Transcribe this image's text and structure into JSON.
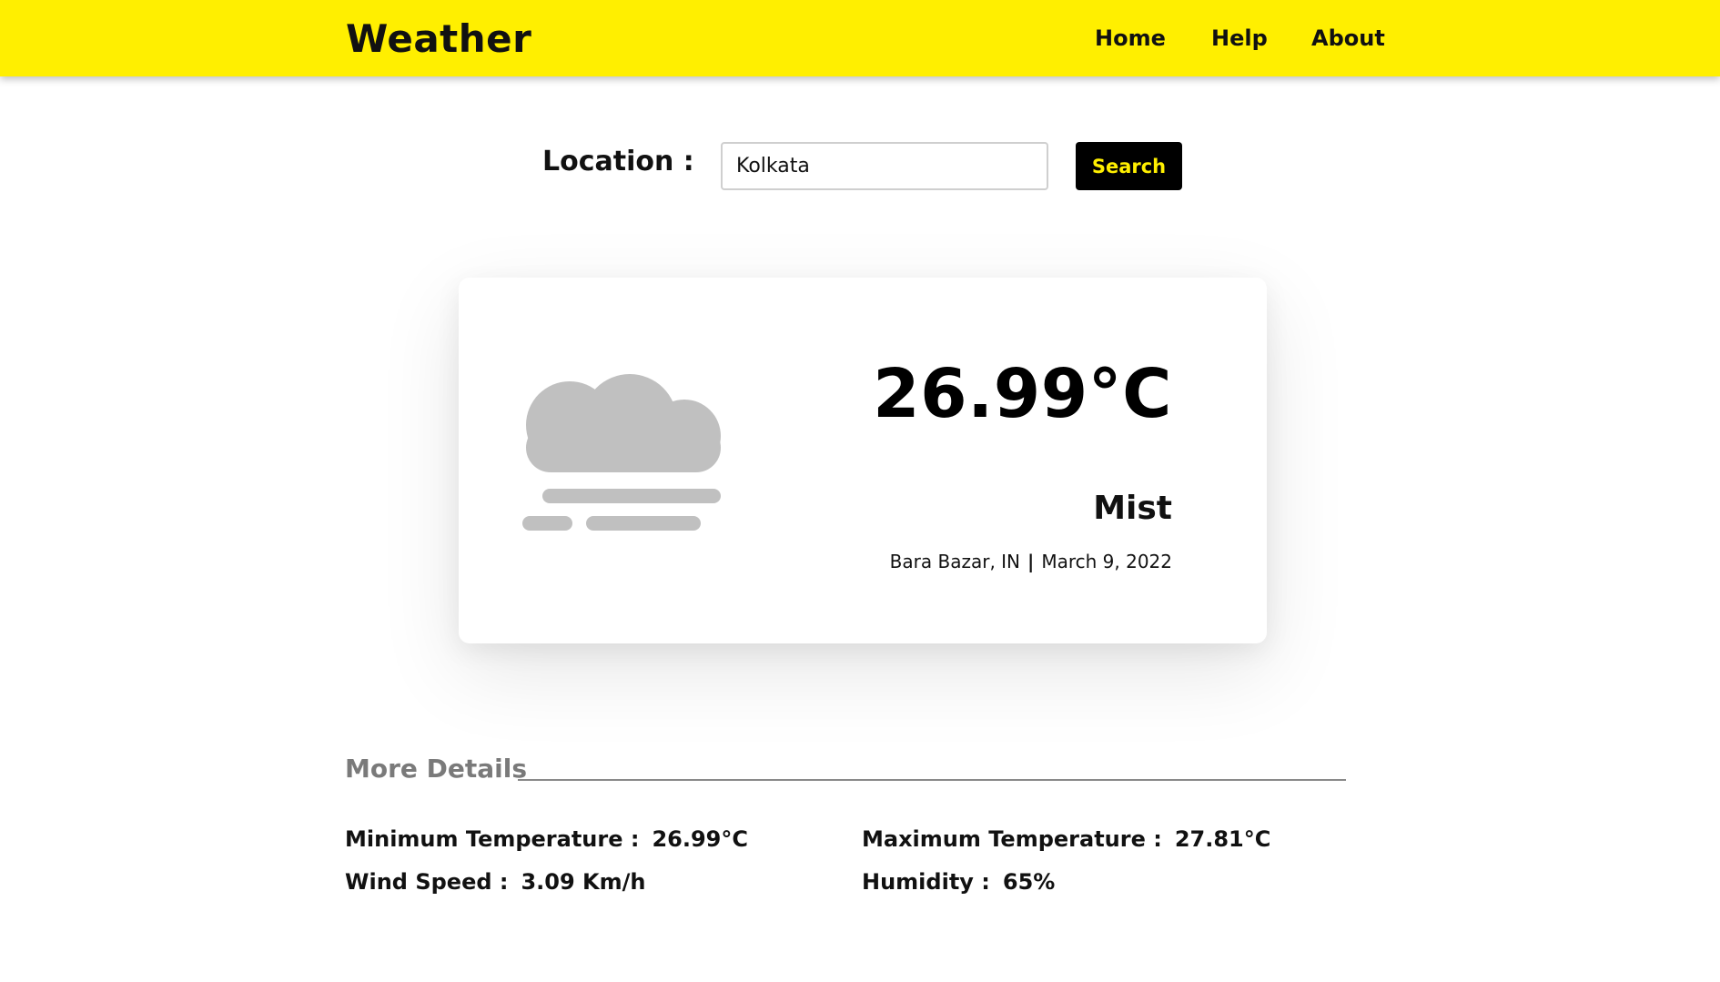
{
  "navbar": {
    "brand": "Weather",
    "links": [
      "Home",
      "Help",
      "About"
    ],
    "background_color": "#ffef00"
  },
  "search": {
    "label": "Location :",
    "value": "Kolkata",
    "button_label": "Search"
  },
  "current": {
    "icon": "mist-icon",
    "temperature": "26.99°C",
    "condition": "Mist",
    "location": "Bara Bazar, IN",
    "separator": "|",
    "date": "March 9, 2022"
  },
  "details": {
    "title": "More Details",
    "min_temp": {
      "label": "Minimum Temperature :",
      "value": "26.99°C"
    },
    "max_temp": {
      "label": "Maximum Temperature :",
      "value": "27.81°C"
    },
    "wind": {
      "label": "Wind Speed :",
      "value": "3.09 Km/h"
    },
    "humidity": {
      "label": "Humidity :",
      "value": "65%"
    }
  }
}
